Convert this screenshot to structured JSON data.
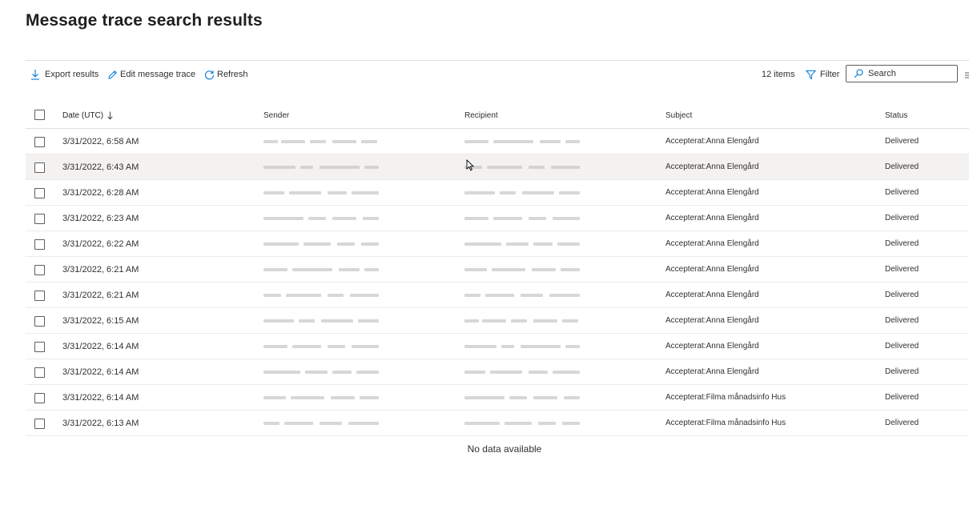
{
  "page": {
    "title": "Message trace search results"
  },
  "toolbar": {
    "export_label": "Export results",
    "edit_label": "Edit message trace",
    "refresh_label": "Refresh",
    "items_count": "12 items",
    "filter_label": "Filter",
    "search_placeholder": "Search"
  },
  "table": {
    "columns": {
      "date": "Date (UTC)",
      "sender": "Sender",
      "recipient": "Recipient",
      "subject": "Subject",
      "status": "Status"
    },
    "sort": "descending",
    "rows": [
      {
        "date": "3/31/2022, 6:58 AM",
        "subject": "Accepterat:Anna Elengård",
        "status": "Delivered"
      },
      {
        "date": "3/31/2022, 6:43 AM",
        "subject": "Accepterat:Anna Elengård",
        "status": "Delivered"
      },
      {
        "date": "3/31/2022, 6:28 AM",
        "subject": "Accepterat:Anna Elengård",
        "status": "Delivered"
      },
      {
        "date": "3/31/2022, 6:23 AM",
        "subject": "Accepterat:Anna Elengård",
        "status": "Delivered"
      },
      {
        "date": "3/31/2022, 6:22 AM",
        "subject": "Accepterat:Anna Elengård",
        "status": "Delivered"
      },
      {
        "date": "3/31/2022, 6:21 AM",
        "subject": "Accepterat:Anna Elengård",
        "status": "Delivered"
      },
      {
        "date": "3/31/2022, 6:21 AM",
        "subject": "Accepterat:Anna Elengård",
        "status": "Delivered"
      },
      {
        "date": "3/31/2022, 6:15 AM",
        "subject": "Accepterat:Anna Elengård",
        "status": "Delivered"
      },
      {
        "date": "3/31/2022, 6:14 AM",
        "subject": "Accepterat:Anna Elengård",
        "status": "Delivered"
      },
      {
        "date": "3/31/2022, 6:14 AM",
        "subject": "Accepterat:Anna Elengård",
        "status": "Delivered"
      },
      {
        "date": "3/31/2022, 6:14 AM",
        "subject": "Accepterat:Filma månadsinfo Hus",
        "status": "Delivered"
      },
      {
        "date": "3/31/2022, 6:13 AM",
        "subject": "Accepterat:Filma månadsinfo Hus",
        "status": "Delivered"
      }
    ],
    "empty_message": "No data available"
  },
  "colors": {
    "accent": "#0078d4",
    "text": "#323130",
    "divider": "#e1dfdd",
    "hover_row": "#f3f2f1"
  },
  "icons": {
    "export": "download-icon",
    "edit": "pencil-icon",
    "refresh": "refresh-icon",
    "filter": "filter-icon",
    "search": "search-icon",
    "more": "more-icon",
    "sort": "arrow-down-icon"
  }
}
